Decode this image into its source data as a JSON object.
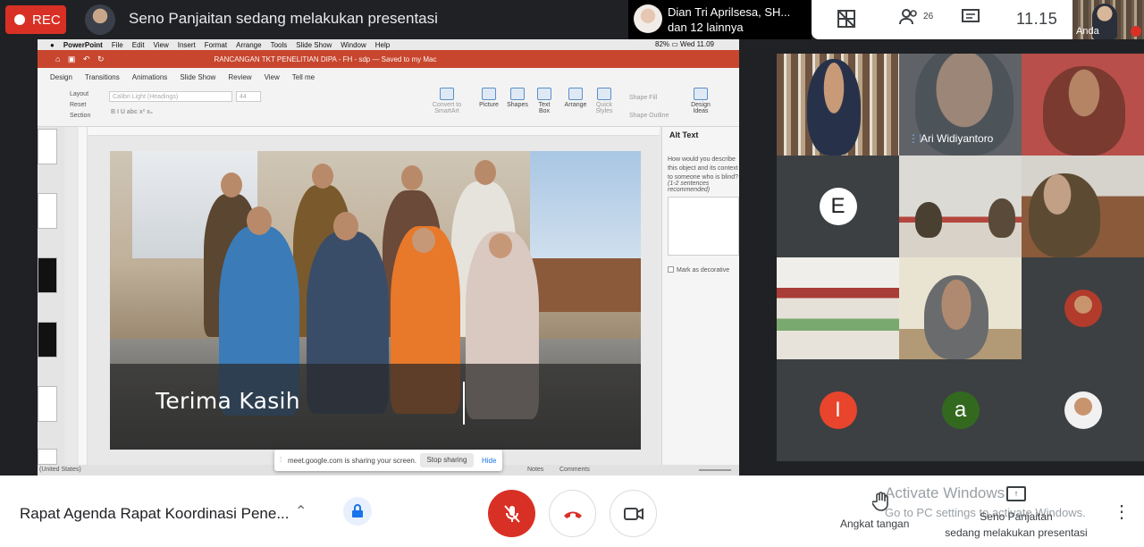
{
  "topbar": {
    "rec_label": "REC",
    "presenting_text": "Seno Panjaitan sedang melakukan presentasi",
    "participant_name": "Dian Tri Aprilsesa, SH...",
    "participant_others": "dan 12 lainnya",
    "people_count": "26",
    "clock": "11.15",
    "self_label": "Anda"
  },
  "shared_screen": {
    "mac_menu": [
      "PowerPoint",
      "File",
      "Edit",
      "View",
      "Insert",
      "Format",
      "Arrange",
      "Tools",
      "Slide Show",
      "Window",
      "Help"
    ],
    "mac_status": "82% ▭  Wed 11.09",
    "doc_title": "RANCANGAN TKT PENELITIAN DIPA - FH - sdp — Saved to my Mac",
    "ribbon_tabs": [
      "Design",
      "Transitions",
      "Animations",
      "Slide Show",
      "Review",
      "View",
      "Tell me"
    ],
    "ribbon": {
      "layout": "Layout",
      "reset": "Reset",
      "section": "Section",
      "font": "Calibri Light (Headings)",
      "font_size": "44",
      "convert": "Convert to SmartArt",
      "picture": "Picture",
      "shapes": "Shapes",
      "textbox": "Text Box",
      "arrange": "Arrange",
      "quick_styles": "Quick Styles",
      "shape_fill": "Shape Fill",
      "shape_outline": "Shape Outline",
      "design_ideas": "Design Ideas"
    },
    "slide_caption": "Terima Kasih",
    "alt_text": {
      "title": "Alt Text",
      "description": "How would you describe this object and its context to someone who is blind?",
      "hint": "(1-2 sentences recommended)",
      "checkbox": "Mark as decorative"
    },
    "status": {
      "lang": "(United States)",
      "notes": "Notes",
      "comments": "Comments"
    },
    "share_bar": {
      "message": "meet.google.com is sharing your screen.",
      "stop": "Stop sharing",
      "hide": "Hide"
    }
  },
  "participants": {
    "speaker_name": "Ari Widiyantoro",
    "initial_e": "E",
    "initial_i": "I",
    "initial_a": "a",
    "colors": {
      "e": "#202124",
      "i": "#e8452c",
      "a": "#33691e"
    }
  },
  "bottombar": {
    "meeting_title": "Rapat Agenda Rapat Koordinasi Pene...",
    "activate_title": "Activate Windows",
    "activate_sub": "Go to PC settings to activate Windows.",
    "raise_hand": "Angkat tangan",
    "presenter_line1": "Seno Panjaitan",
    "presenter_line2": "sedang melakukan presentasi"
  },
  "icons": {
    "chevron": "⌃",
    "lock": "🔒",
    "mic_off": "🎙",
    "hangup": "☎",
    "camera": "▭",
    "hand": "✋",
    "more": "⋮"
  },
  "theme": {
    "rec_red": "#d93025",
    "accent_blue": "#1a73e8",
    "ppt_orange": "#c8462e"
  }
}
